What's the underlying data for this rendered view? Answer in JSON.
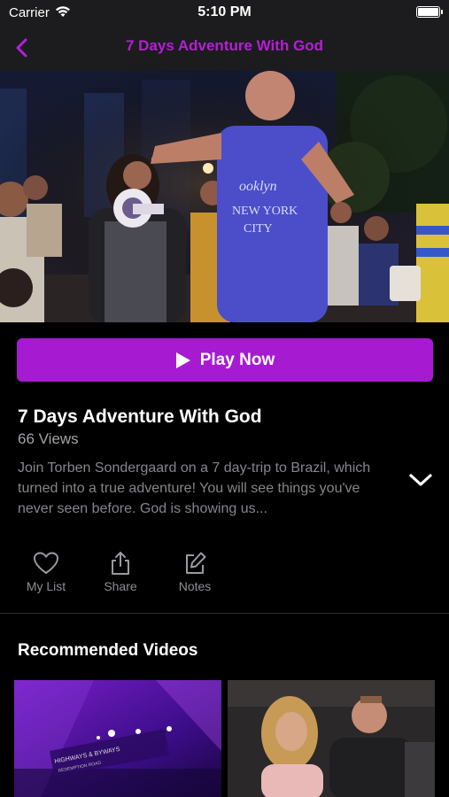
{
  "status_bar": {
    "carrier": "Carrier",
    "time": "5:10 PM"
  },
  "nav": {
    "title": "7 Days Adventure With God"
  },
  "play_button": {
    "label": "Play Now"
  },
  "video": {
    "title": "7 Days Adventure With God",
    "views": "66 Views",
    "description": "Join Torben Sondergaard on a 7 day-trip to Brazil, which turned into a true adventure! You will see things you've never seen before. God is showing us..."
  },
  "actions": [
    {
      "label": "My List",
      "icon": "heart-icon"
    },
    {
      "label": "Share",
      "icon": "share-icon"
    },
    {
      "label": "Notes",
      "icon": "edit-icon"
    }
  ],
  "recommended": {
    "title": "Recommended Videos",
    "items": [
      {
        "overlay_line1": "HIGHWAYS & BYWAYS",
        "overlay_line2": "REDEMPTION ROAD"
      },
      {
        "overlay_line1": ""
      }
    ]
  },
  "colors": {
    "accent": "#a61bd1",
    "title_accent": "#b41fd6",
    "bar": "#1c1c1e"
  }
}
